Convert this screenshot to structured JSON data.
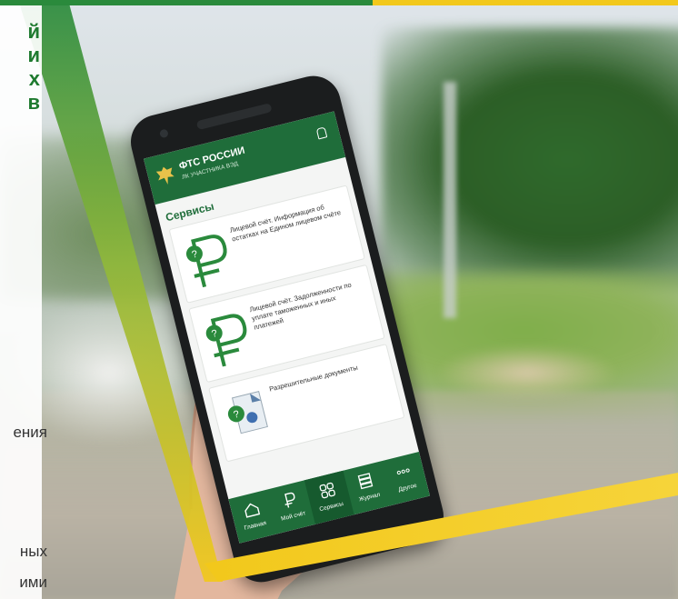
{
  "left_panel": {
    "title_lines": [
      "й",
      "и",
      "х",
      "в"
    ],
    "text_line_1": "ения",
    "text_line_2": "ных",
    "text_line_3": "ими"
  },
  "app": {
    "title": "ФТС РОССИИ",
    "subtitle": "ЛК УЧАСТНИКА ВЭД",
    "section": "Сервисы",
    "cards": [
      {
        "text": "Лицевой счёт. Информация об остатках на Едином лицевом счёте",
        "icon": "ruble-question-icon"
      },
      {
        "text": "Лицевой счёт. Задолженности по уплате таможенных и иных платежей",
        "icon": "ruble-question-icon"
      },
      {
        "text": "Разрешительные документы",
        "icon": "document-question-icon"
      }
    ],
    "tabs": [
      {
        "label": "Главная",
        "icon": "home-icon"
      },
      {
        "label": "Мой счёт",
        "icon": "ruble-icon"
      },
      {
        "label": "Сервисы",
        "icon": "grid-icon"
      },
      {
        "label": "Журнал",
        "icon": "stack-icon"
      },
      {
        "label": "Другое",
        "icon": "more-icon"
      }
    ]
  },
  "colors": {
    "brand_green": "#1f6d3a",
    "accent_yellow": "#f2c81b",
    "stripe_green": "#2a8a3c"
  }
}
